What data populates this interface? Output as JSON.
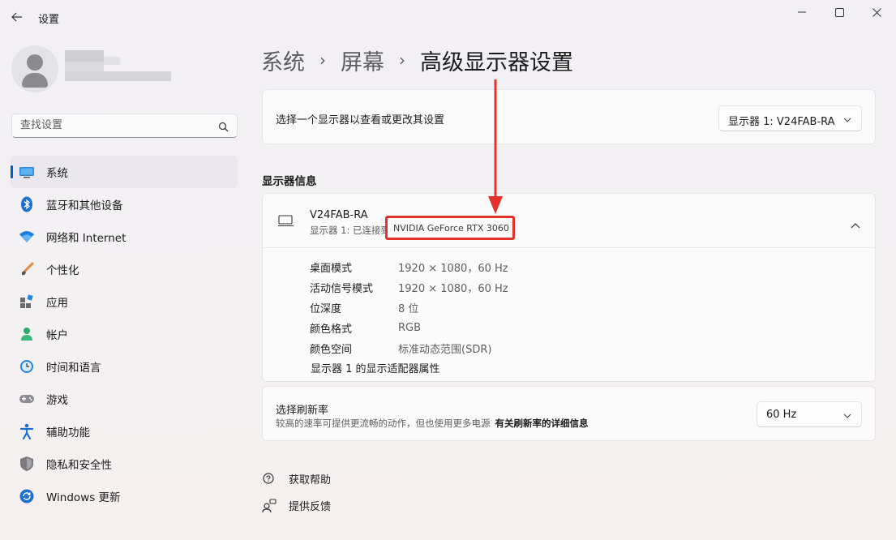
{
  "window": {
    "title": "设置"
  },
  "sidebar": {
    "search_placeholder": "查找设置",
    "items": [
      {
        "label": "系统",
        "icon": "system-icon",
        "active": true
      },
      {
        "label": "蓝牙和其他设备",
        "icon": "bluetooth-icon"
      },
      {
        "label": "网络和 Internet",
        "icon": "wifi-icon"
      },
      {
        "label": "个性化",
        "icon": "brush-icon"
      },
      {
        "label": "应用",
        "icon": "apps-icon"
      },
      {
        "label": "帐户",
        "icon": "account-icon"
      },
      {
        "label": "时间和语言",
        "icon": "clock-globe-icon"
      },
      {
        "label": "游戏",
        "icon": "gamepad-icon"
      },
      {
        "label": "辅助功能",
        "icon": "accessibility-icon"
      },
      {
        "label": "隐私和安全性",
        "icon": "shield-icon"
      },
      {
        "label": "Windows 更新",
        "icon": "update-icon"
      }
    ]
  },
  "breadcrumb": {
    "part1": "系统",
    "part2": "屏幕",
    "current": "高级显示器设置"
  },
  "select_display": {
    "label": "选择一个显示器以查看或更改其设置",
    "value": "显示器 1: V24FAB-RA"
  },
  "section_title": "显示器信息",
  "display_info": {
    "name": "V24FAB-RA",
    "subtitle": "显示器 1: 已连接到",
    "gpu": "NVIDIA GeForce RTX 3060",
    "rows": [
      {
        "key": "桌面模式",
        "value": "1920 × 1080，60 Hz"
      },
      {
        "key": "活动信号模式",
        "value": "1920 × 1080，60 Hz"
      },
      {
        "key": "位深度",
        "value": "8 位"
      },
      {
        "key": "颜色格式",
        "value": "RGB"
      },
      {
        "key": "颜色空间",
        "value": "标准动态范围(SDR)"
      }
    ],
    "adapter_link": "显示器 1 的显示适配器属性"
  },
  "refresh_rate": {
    "title": "选择刷新率",
    "description": "较高的速率可提供更流畅的动作，但也使用更多电源",
    "link": "有关刷新率的详细信息",
    "value": "60 Hz"
  },
  "help": {
    "get_help": "获取帮助",
    "feedback": "提供反馈"
  },
  "colors": {
    "accent": "#005fb8",
    "annotation": "#e4312b"
  }
}
